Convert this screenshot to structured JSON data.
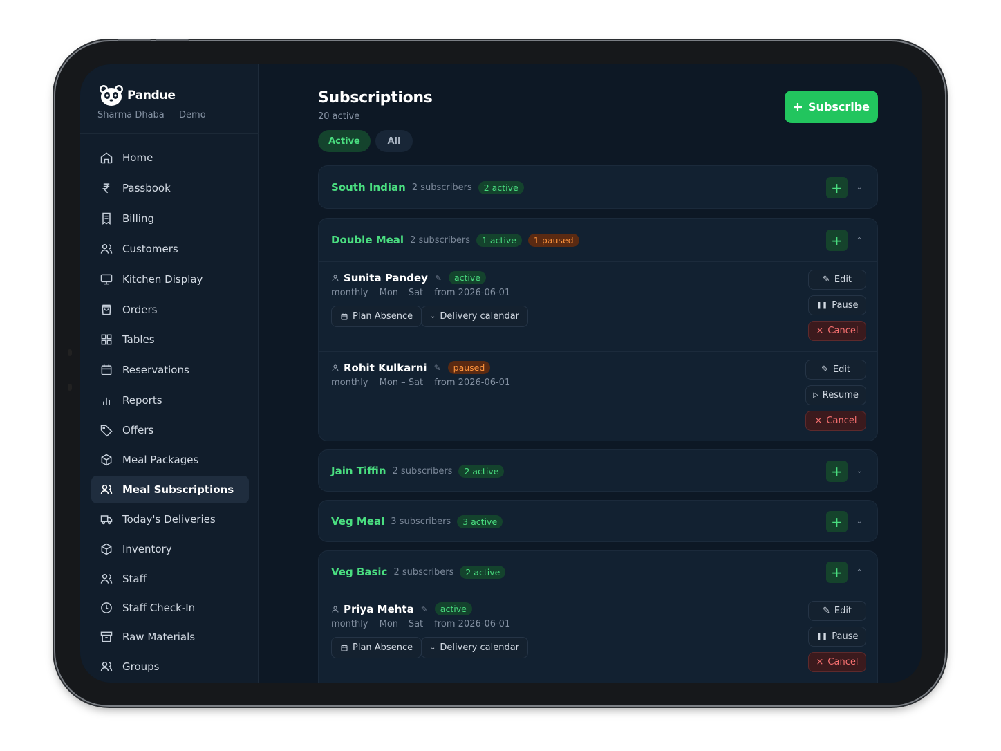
{
  "brand": {
    "name": "Pandue",
    "subtitle": "Sharma Dhaba — Demo"
  },
  "nav": [
    {
      "label": "Home",
      "icon": "home-icon"
    },
    {
      "label": "Passbook",
      "icon": "rupee-icon"
    },
    {
      "label": "Billing",
      "icon": "receipt-icon"
    },
    {
      "label": "Customers",
      "icon": "users-icon"
    },
    {
      "label": "Kitchen Display",
      "icon": "monitor-icon"
    },
    {
      "label": "Orders",
      "icon": "bag-icon"
    },
    {
      "label": "Tables",
      "icon": "grid-icon"
    },
    {
      "label": "Reservations",
      "icon": "calendar-icon"
    },
    {
      "label": "Reports",
      "icon": "bar-chart-icon"
    },
    {
      "label": "Offers",
      "icon": "tag-icon"
    },
    {
      "label": "Meal Packages",
      "icon": "package-icon"
    },
    {
      "label": "Meal Subscriptions",
      "icon": "users-icon",
      "active": true
    },
    {
      "label": "Today's Deliveries",
      "icon": "truck-icon"
    },
    {
      "label": "Inventory",
      "icon": "package-icon"
    },
    {
      "label": "Staff",
      "icon": "users-icon"
    },
    {
      "label": "Staff Check-In",
      "icon": "clock-icon"
    },
    {
      "label": "Raw Materials",
      "icon": "archive-icon"
    },
    {
      "label": "Groups",
      "icon": "users-icon"
    }
  ],
  "header": {
    "title": "Subscriptions",
    "subtitle": "20 active",
    "filter_active": "Active",
    "filter_all": "All",
    "subscribe_label": "Subscribe"
  },
  "groups": [
    {
      "name": "South Indian",
      "subscribers": "2 subscribers",
      "active": "2 active"
    },
    {
      "name": "Double Meal",
      "subscribers": "2 subscribers",
      "active": "1 active",
      "paused": "1 paused",
      "rows": [
        {
          "name": "Sunita Pandey",
          "status": "active",
          "plan": "monthly",
          "days": "Mon – Sat",
          "from": "from 2026-06-01",
          "plan_absence": "Plan Absence",
          "delivery_calendar": "Delivery calendar",
          "edit": "Edit",
          "toggle": "Pause",
          "cancel": "Cancel"
        },
        {
          "name": "Rohit Kulkarni",
          "status": "paused",
          "plan": "monthly",
          "days": "Mon – Sat",
          "from": "from 2026-06-01",
          "edit": "Edit",
          "toggle": "Resume",
          "cancel": "Cancel"
        }
      ]
    },
    {
      "name": "Jain Tiffin",
      "subscribers": "2 subscribers",
      "active": "2 active"
    },
    {
      "name": "Veg Meal",
      "subscribers": "3 subscribers",
      "active": "3 active"
    },
    {
      "name": "Veg Basic",
      "subscribers": "2 subscribers",
      "active": "2 active",
      "rows": [
        {
          "name": "Priya Mehta",
          "status": "active",
          "plan": "monthly",
          "days": "Mon – Sat",
          "from": "from 2026-06-01",
          "plan_absence": "Plan Absence",
          "delivery_calendar": "Delivery calendar",
          "edit": "Edit",
          "toggle": "Pause",
          "cancel": "Cancel"
        }
      ]
    }
  ],
  "colors": {
    "accent": "#22c55e",
    "paused": "#fb923c",
    "danger": "#f87171",
    "background": "#0d1825"
  }
}
